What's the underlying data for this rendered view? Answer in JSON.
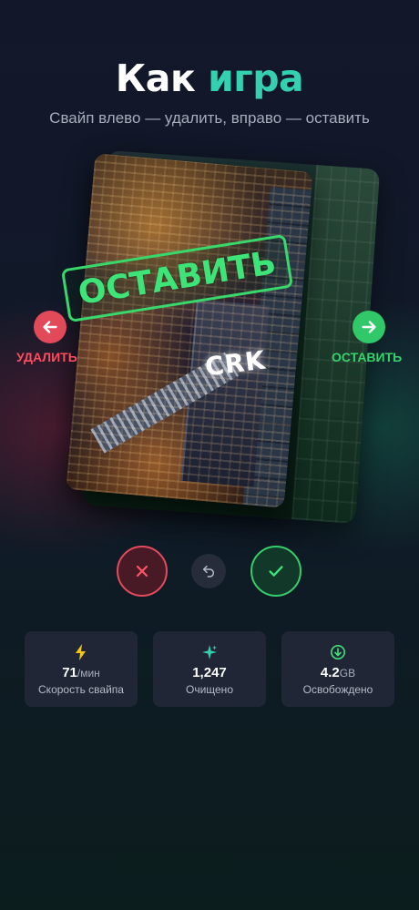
{
  "header": {
    "title_main": "Как",
    "title_accent": "игра",
    "subtitle": "Свайп влево — удалить, вправо — оставить"
  },
  "card": {
    "stamp_label": "ОСТАВИТЬ",
    "sign_text": "CRK"
  },
  "swipe_hints": {
    "left_label": "УДАЛИТЬ",
    "right_label": "ОСТАВИТЬ"
  },
  "actions": {
    "reject_icon": "close-icon",
    "undo_icon": "undo-icon",
    "accept_icon": "check-icon"
  },
  "stats": [
    {
      "icon": "lightning-icon",
      "value": "71",
      "unit": "/мин",
      "label": "Скорость свайпа"
    },
    {
      "icon": "sparkle-icon",
      "value": "1,247",
      "unit": "",
      "label": "Очищено"
    },
    {
      "icon": "download-circle-icon",
      "value": "4.2",
      "unit": "GB",
      "label": "Освобождено"
    }
  ],
  "colors": {
    "accent": "#33d1b0",
    "delete": "#e24a5a",
    "keep": "#31c86a"
  }
}
